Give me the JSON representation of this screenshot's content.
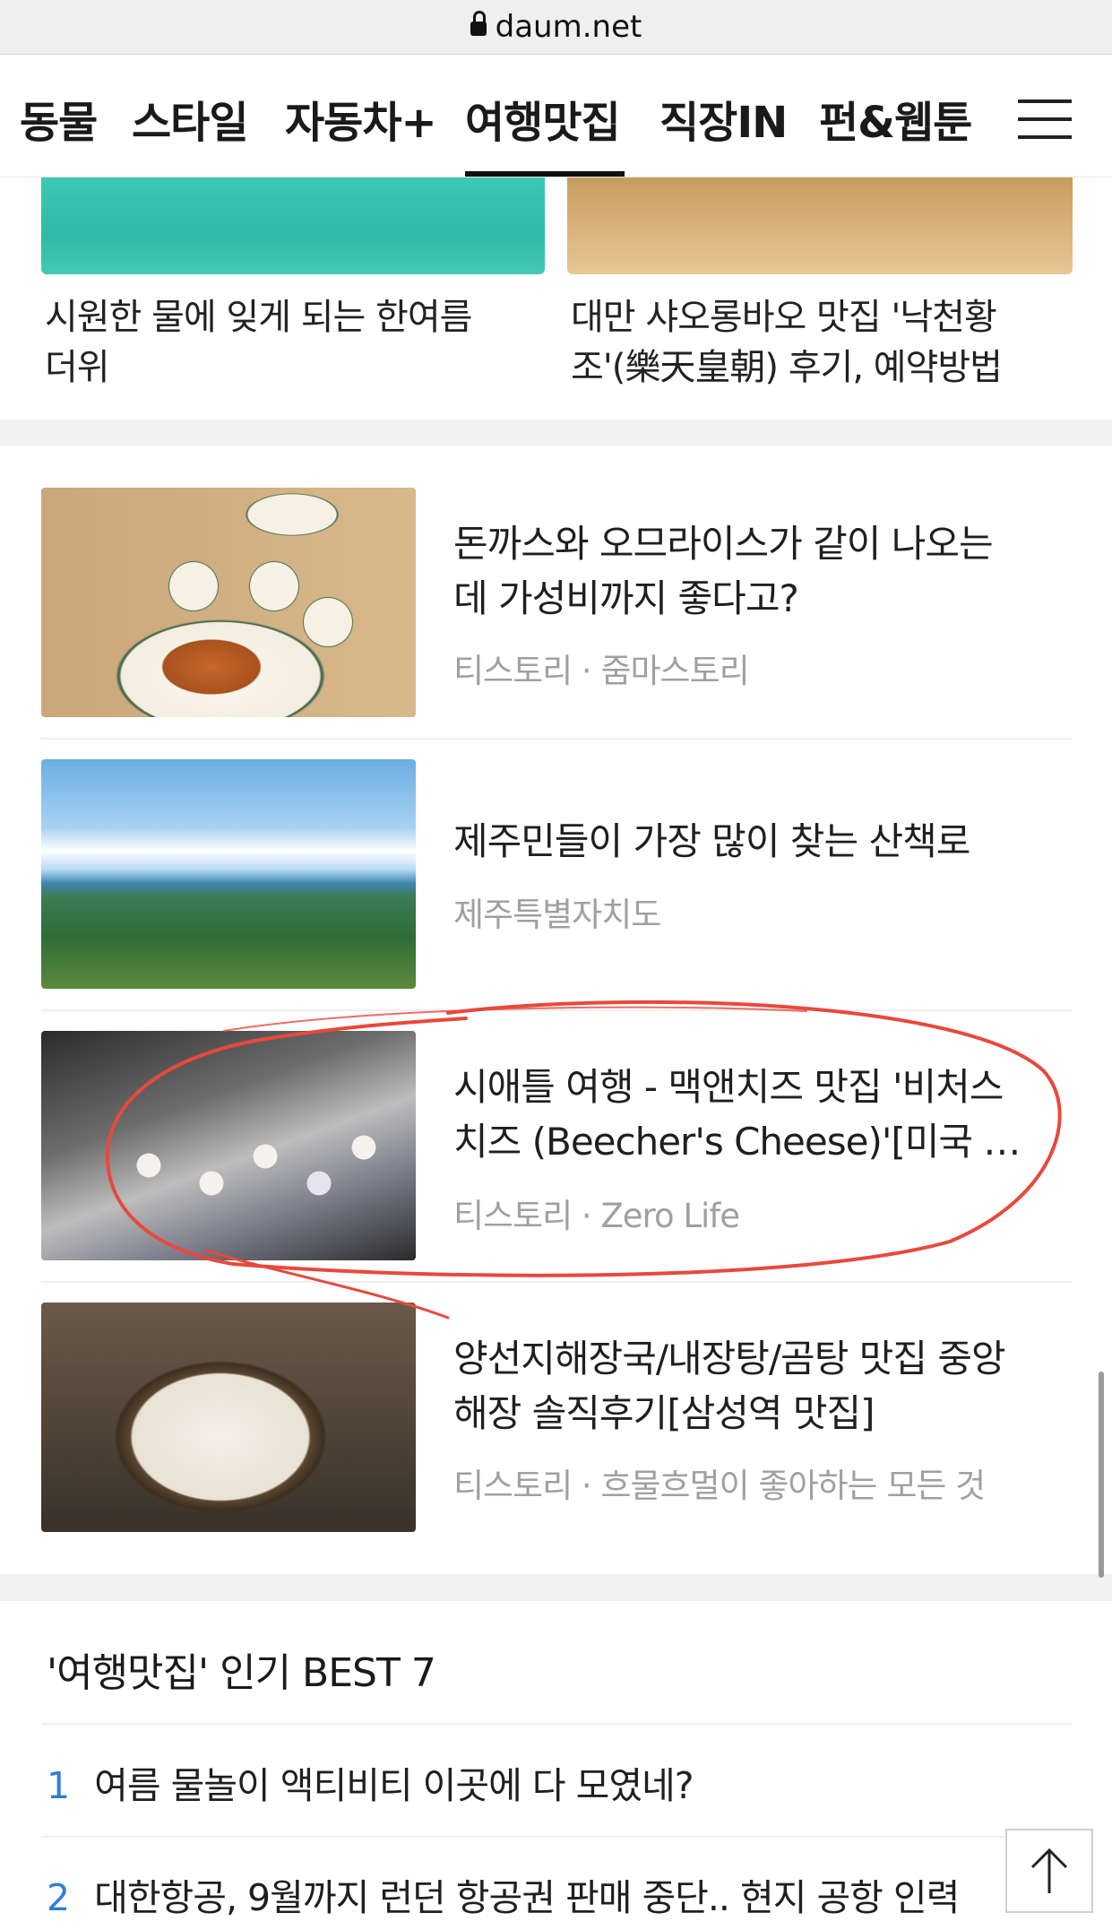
{
  "browser": {
    "domain": "daum.net"
  },
  "tabs": [
    {
      "label": "동물"
    },
    {
      "label": "스타일"
    },
    {
      "label": "자동차+"
    },
    {
      "label": "여행맛집",
      "active": true
    },
    {
      "label": "직장IN"
    },
    {
      "label": "펀&웹툰"
    }
  ],
  "top_cards": [
    {
      "caption_line1": "시원한 물에 잊게 되는 한여름",
      "caption_line2": "더위"
    },
    {
      "caption_line1": "대만 샤오롱바오 맛집 '낙천황",
      "caption_line2": "조'(樂天皇朝) 후기, 예약방법"
    }
  ],
  "articles": [
    {
      "title_line1": "돈까스와 오므라이스가 같이 나오는",
      "title_line2": "데 가성비까지 좋다고?",
      "meta": "티스토리 · 줌마스토리"
    },
    {
      "title_line1": "제주민들이 가장 많이 찾는 산책로",
      "title_line2": "",
      "meta": "제주특별자치도"
    },
    {
      "title_line1": "시애틀 여행 - 맥앤치즈 맛집 '비처스",
      "title_line2": "치즈 (Beecher's Cheese)'[미국 …",
      "meta": "티스토리 · Zero Life"
    },
    {
      "title_line1": "양선지해장국/내장탕/곰탕 맛집 중앙",
      "title_line2": "해장 솔직후기[삼성역 맛집]",
      "meta": "티스토리 · 흐물흐멀이 좋아하는 모든 것"
    }
  ],
  "best": {
    "title": "'여행맛집' 인기 BEST 7",
    "items": [
      {
        "rank": "1",
        "text": "여름 물놀이 액티비티 이곳에 다 모였네?"
      },
      {
        "rank": "2",
        "text": "대한항공, 9월까지 런던 항공권 판매 중단.. 현지 공항 인력"
      }
    ]
  },
  "colors": {
    "accent_blue": "#2f7fd6",
    "annotation_red": "#e8493c",
    "meta_gray": "#a0a0a0"
  },
  "icons": {
    "lock": "lock-icon",
    "menu": "hamburger-menu-icon",
    "scroll_top": "arrow-up-icon"
  }
}
